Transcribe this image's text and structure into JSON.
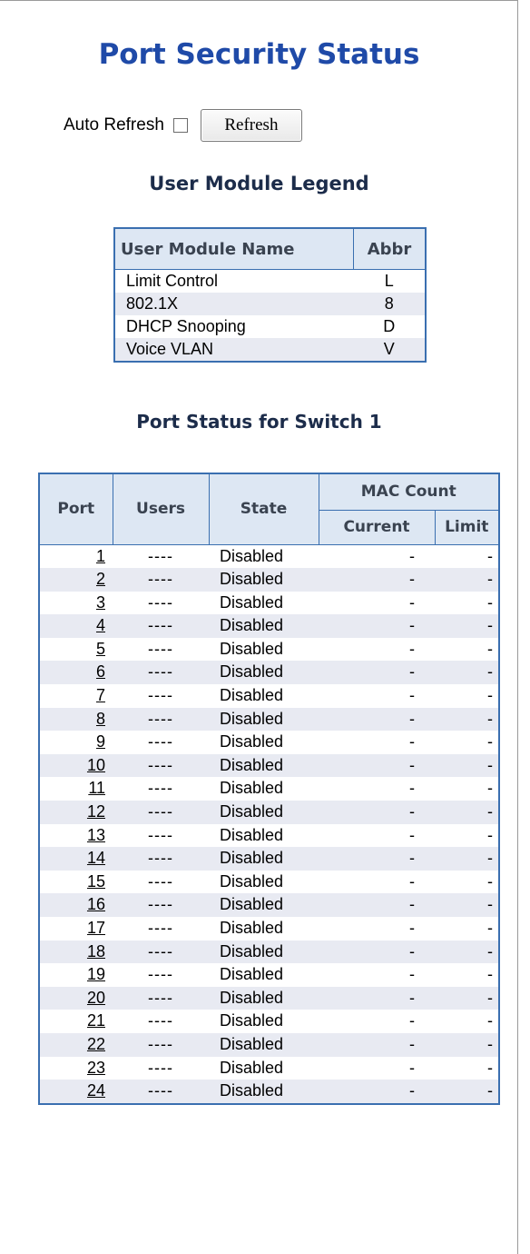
{
  "page": {
    "title": "Port Security Status",
    "auto_refresh_label": "Auto Refresh",
    "auto_refresh_checked": false,
    "refresh_button": "Refresh"
  },
  "legend": {
    "title": "User Module Legend",
    "headers": [
      "User Module Name",
      "Abbr"
    ],
    "rows": [
      {
        "name": "Limit Control",
        "abbr": "L"
      },
      {
        "name": "802.1X",
        "abbr": "8"
      },
      {
        "name": "DHCP Snooping",
        "abbr": "D"
      },
      {
        "name": "Voice VLAN",
        "abbr": "V"
      }
    ]
  },
  "port_status": {
    "title": "Port Status for Switch 1",
    "headers": {
      "port": "Port",
      "users": "Users",
      "state": "State",
      "mac_count": "MAC Count",
      "current": "Current",
      "limit": "Limit"
    },
    "rows": [
      {
        "port": "1",
        "users": "----",
        "state": "Disabled",
        "current": "-",
        "limit": "-"
      },
      {
        "port": "2",
        "users": "----",
        "state": "Disabled",
        "current": "-",
        "limit": "-"
      },
      {
        "port": "3",
        "users": "----",
        "state": "Disabled",
        "current": "-",
        "limit": "-"
      },
      {
        "port": "4",
        "users": "----",
        "state": "Disabled",
        "current": "-",
        "limit": "-"
      },
      {
        "port": "5",
        "users": "----",
        "state": "Disabled",
        "current": "-",
        "limit": "-"
      },
      {
        "port": "6",
        "users": "----",
        "state": "Disabled",
        "current": "-",
        "limit": "-"
      },
      {
        "port": "7",
        "users": "----",
        "state": "Disabled",
        "current": "-",
        "limit": "-"
      },
      {
        "port": "8",
        "users": "----",
        "state": "Disabled",
        "current": "-",
        "limit": "-"
      },
      {
        "port": "9",
        "users": "----",
        "state": "Disabled",
        "current": "-",
        "limit": "-"
      },
      {
        "port": "10",
        "users": "----",
        "state": "Disabled",
        "current": "-",
        "limit": "-"
      },
      {
        "port": "11",
        "users": "----",
        "state": "Disabled",
        "current": "-",
        "limit": "-"
      },
      {
        "port": "12",
        "users": "----",
        "state": "Disabled",
        "current": "-",
        "limit": "-"
      },
      {
        "port": "13",
        "users": "----",
        "state": "Disabled",
        "current": "-",
        "limit": "-"
      },
      {
        "port": "14",
        "users": "----",
        "state": "Disabled",
        "current": "-",
        "limit": "-"
      },
      {
        "port": "15",
        "users": "----",
        "state": "Disabled",
        "current": "-",
        "limit": "-"
      },
      {
        "port": "16",
        "users": "----",
        "state": "Disabled",
        "current": "-",
        "limit": "-"
      },
      {
        "port": "17",
        "users": "----",
        "state": "Disabled",
        "current": "-",
        "limit": "-"
      },
      {
        "port": "18",
        "users": "----",
        "state": "Disabled",
        "current": "-",
        "limit": "-"
      },
      {
        "port": "19",
        "users": "----",
        "state": "Disabled",
        "current": "-",
        "limit": "-"
      },
      {
        "port": "20",
        "users": "----",
        "state": "Disabled",
        "current": "-",
        "limit": "-"
      },
      {
        "port": "21",
        "users": "----",
        "state": "Disabled",
        "current": "-",
        "limit": "-"
      },
      {
        "port": "22",
        "users": "----",
        "state": "Disabled",
        "current": "-",
        "limit": "-"
      },
      {
        "port": "23",
        "users": "----",
        "state": "Disabled",
        "current": "-",
        "limit": "-"
      },
      {
        "port": "24",
        "users": "----",
        "state": "Disabled",
        "current": "-",
        "limit": "-"
      }
    ]
  },
  "colors": {
    "title": "#1f4aa8",
    "table_border": "#3a6fb0",
    "header_bg": "#dde7f3",
    "stripe_bg": "#e8eaf2"
  }
}
